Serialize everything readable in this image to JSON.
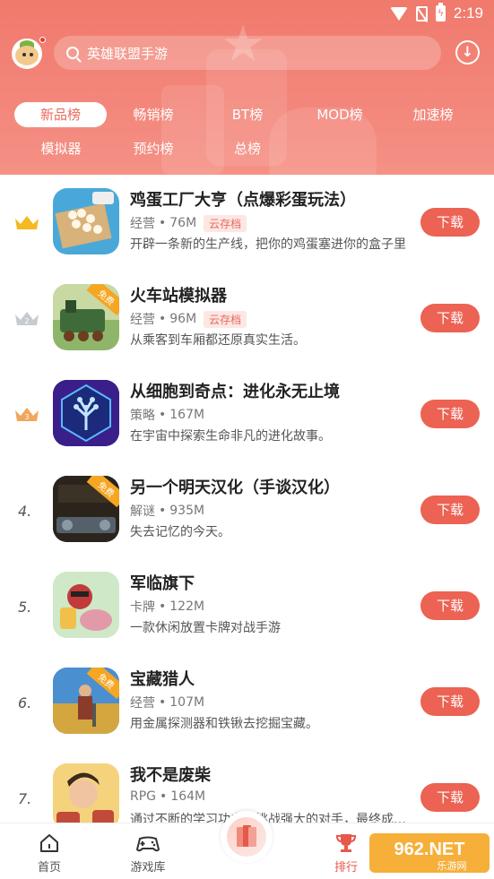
{
  "status_bar": {
    "time": "2:19"
  },
  "search": {
    "placeholder": "英雄联盟手游"
  },
  "tabs": [
    {
      "label": "新品榜",
      "active": true
    },
    {
      "label": "畅销榜",
      "active": false
    },
    {
      "label": "BT榜",
      "active": false
    },
    {
      "label": "MOD榜",
      "active": false
    },
    {
      "label": "加速榜",
      "active": false
    },
    {
      "label": "模拟器",
      "active": false
    },
    {
      "label": "预约榜",
      "active": false
    },
    {
      "label": "总榜",
      "active": false
    }
  ],
  "apps": [
    {
      "rank": "1",
      "title": "鸡蛋工厂大亨（点爆彩蛋玩法）",
      "category": "经营",
      "size": "76M",
      "badge": "云存档",
      "desc": "开辟一条新的生产线，把你的鸡蛋塞进你的盒子里",
      "button": "下载"
    },
    {
      "rank": "2",
      "title": "火车站模拟器",
      "category": "经营",
      "size": "96M",
      "badge": "云存档",
      "desc": "从乘客到车厢都还原真实生活。",
      "button": "下载",
      "free_tag": "免费"
    },
    {
      "rank": "3",
      "title": "从细胞到奇点：进化永无止境",
      "category": "策略",
      "size": "167M",
      "badge": "",
      "desc": "在宇宙中探索生命非凡的进化故事。",
      "button": "下载"
    },
    {
      "rank": "4.",
      "title": "另一个明天汉化（手谈汉化）",
      "category": "解谜",
      "size": "935M",
      "badge": "",
      "desc": "失去记忆的今天。",
      "button": "下载",
      "free_tag": "免费"
    },
    {
      "rank": "5.",
      "title": "军临旗下",
      "category": "卡牌",
      "size": "122M",
      "badge": "",
      "desc": "一款休闲放置卡牌对战手游",
      "button": "下载"
    },
    {
      "rank": "6.",
      "title": "宝藏猎人",
      "category": "经营",
      "size": "107M",
      "badge": "",
      "desc": "用金属探测器和铁锹去挖掘宝藏。",
      "button": "下载",
      "free_tag": "免费"
    },
    {
      "rank": "7.",
      "title": "我不是废柴",
      "category": "RPG",
      "size": "164M",
      "badge": "",
      "desc": "通过不断的学习功夫，挑战强大的对手，最终成为大师",
      "button": "下载"
    }
  ],
  "nav": [
    {
      "label": "首页",
      "active": false
    },
    {
      "label": "游戏库",
      "active": false
    },
    {
      "label": "排行",
      "active": true
    }
  ],
  "watermark": {
    "text": "962.NET",
    "sub": "乐游网"
  },
  "colors": {
    "accent": "#ec6253",
    "header": "#f07a6c"
  }
}
